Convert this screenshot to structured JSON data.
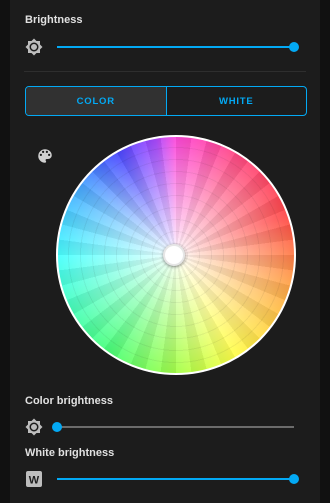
{
  "brightness": {
    "label": "Brightness",
    "icon": "brightness-icon",
    "value_fraction": 1.0
  },
  "tabs": [
    {
      "label": "COLOR",
      "active": true
    },
    {
      "label": "WHITE",
      "active": false
    }
  ],
  "color_wheel": {
    "icon": "palette-icon",
    "selected_color": "#ffffff"
  },
  "color_brightness": {
    "label": "Color brightness",
    "icon": "brightness-icon",
    "value_fraction": 0.0
  },
  "white_brightness": {
    "label": "White brightness",
    "icon": "white-w-icon",
    "icon_text": "W",
    "value_fraction": 1.0
  },
  "colors": {
    "accent": "#03a9f4",
    "track": "#6b6b6b",
    "panel": "#1c1c1c"
  }
}
